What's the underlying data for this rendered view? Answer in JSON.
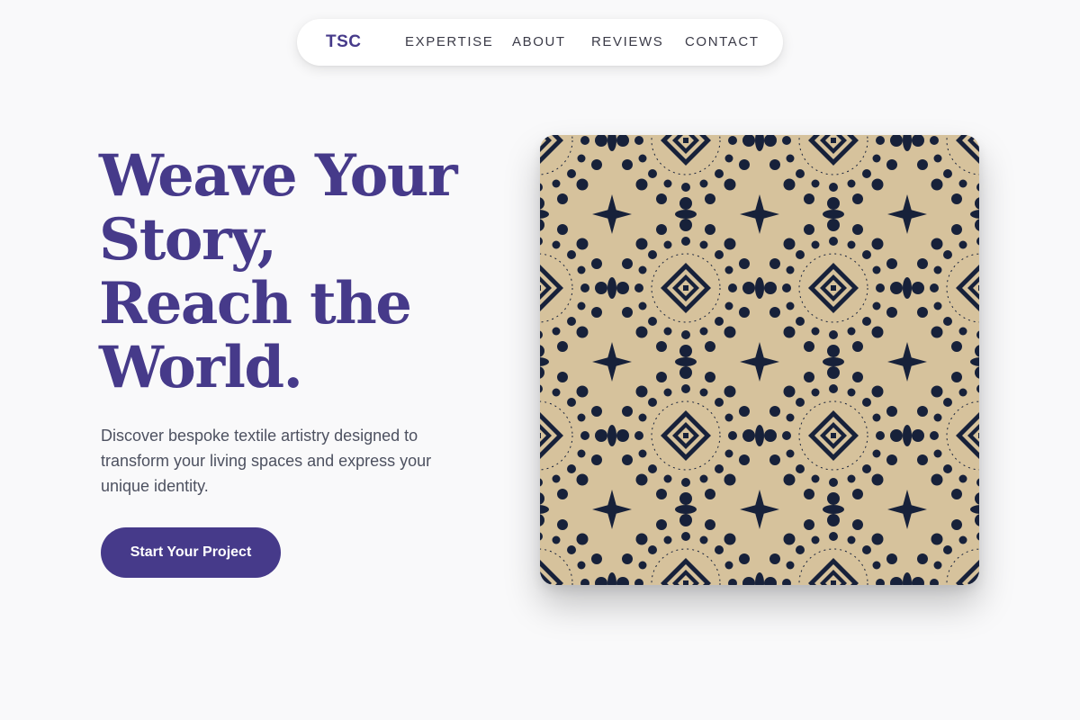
{
  "nav": {
    "logo": "TSC",
    "links": [
      "EXPERTISE",
      "ABOUT",
      "REVIEWS",
      "CONTACT"
    ]
  },
  "hero": {
    "headline_lines": [
      "Weave Your",
      "Story,",
      "Reach the",
      "World."
    ],
    "subtext": "Discover bespoke textile artistry designed to transform your living spaces and express your unique identity.",
    "cta_label": "Start Your Project",
    "image_icon": "textile-pattern"
  },
  "colors": {
    "brand": "#463a8a",
    "background": "#f9f9fa",
    "text_muted": "#4d5160",
    "textile_base": "#d6c29c",
    "textile_ink": "#17213a"
  }
}
